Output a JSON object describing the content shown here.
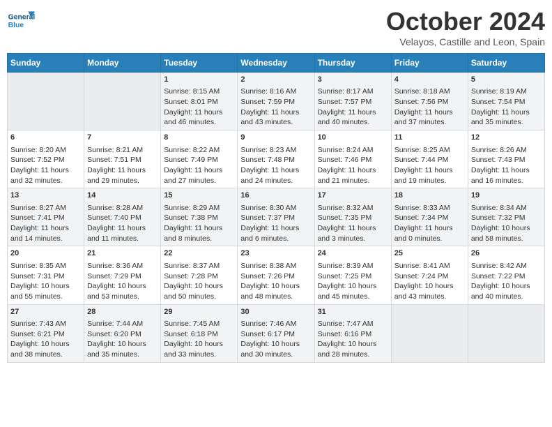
{
  "header": {
    "logo_general": "General",
    "logo_blue": "Blue",
    "month_title": "October 2024",
    "location": "Velayos, Castille and Leon, Spain"
  },
  "days_of_week": [
    "Sunday",
    "Monday",
    "Tuesday",
    "Wednesday",
    "Thursday",
    "Friday",
    "Saturday"
  ],
  "weeks": [
    [
      {
        "day": "",
        "empty": true
      },
      {
        "day": "",
        "empty": true
      },
      {
        "day": "1",
        "sunrise": "8:15 AM",
        "sunset": "8:01 PM",
        "daylight": "11 hours and 46 minutes."
      },
      {
        "day": "2",
        "sunrise": "8:16 AM",
        "sunset": "7:59 PM",
        "daylight": "11 hours and 43 minutes."
      },
      {
        "day": "3",
        "sunrise": "8:17 AM",
        "sunset": "7:57 PM",
        "daylight": "11 hours and 40 minutes."
      },
      {
        "day": "4",
        "sunrise": "8:18 AM",
        "sunset": "7:56 PM",
        "daylight": "11 hours and 37 minutes."
      },
      {
        "day": "5",
        "sunrise": "8:19 AM",
        "sunset": "7:54 PM",
        "daylight": "11 hours and 35 minutes."
      }
    ],
    [
      {
        "day": "6",
        "sunrise": "8:20 AM",
        "sunset": "7:52 PM",
        "daylight": "11 hours and 32 minutes."
      },
      {
        "day": "7",
        "sunrise": "8:21 AM",
        "sunset": "7:51 PM",
        "daylight": "11 hours and 29 minutes."
      },
      {
        "day": "8",
        "sunrise": "8:22 AM",
        "sunset": "7:49 PM",
        "daylight": "11 hours and 27 minutes."
      },
      {
        "day": "9",
        "sunrise": "8:23 AM",
        "sunset": "7:48 PM",
        "daylight": "11 hours and 24 minutes."
      },
      {
        "day": "10",
        "sunrise": "8:24 AM",
        "sunset": "7:46 PM",
        "daylight": "11 hours and 21 minutes."
      },
      {
        "day": "11",
        "sunrise": "8:25 AM",
        "sunset": "7:44 PM",
        "daylight": "11 hours and 19 minutes."
      },
      {
        "day": "12",
        "sunrise": "8:26 AM",
        "sunset": "7:43 PM",
        "daylight": "11 hours and 16 minutes."
      }
    ],
    [
      {
        "day": "13",
        "sunrise": "8:27 AM",
        "sunset": "7:41 PM",
        "daylight": "11 hours and 14 minutes."
      },
      {
        "day": "14",
        "sunrise": "8:28 AM",
        "sunset": "7:40 PM",
        "daylight": "11 hours and 11 minutes."
      },
      {
        "day": "15",
        "sunrise": "8:29 AM",
        "sunset": "7:38 PM",
        "daylight": "11 hours and 8 minutes."
      },
      {
        "day": "16",
        "sunrise": "8:30 AM",
        "sunset": "7:37 PM",
        "daylight": "11 hours and 6 minutes."
      },
      {
        "day": "17",
        "sunrise": "8:32 AM",
        "sunset": "7:35 PM",
        "daylight": "11 hours and 3 minutes."
      },
      {
        "day": "18",
        "sunrise": "8:33 AM",
        "sunset": "7:34 PM",
        "daylight": "11 hours and 0 minutes."
      },
      {
        "day": "19",
        "sunrise": "8:34 AM",
        "sunset": "7:32 PM",
        "daylight": "10 hours and 58 minutes."
      }
    ],
    [
      {
        "day": "20",
        "sunrise": "8:35 AM",
        "sunset": "7:31 PM",
        "daylight": "10 hours and 55 minutes."
      },
      {
        "day": "21",
        "sunrise": "8:36 AM",
        "sunset": "7:29 PM",
        "daylight": "10 hours and 53 minutes."
      },
      {
        "day": "22",
        "sunrise": "8:37 AM",
        "sunset": "7:28 PM",
        "daylight": "10 hours and 50 minutes."
      },
      {
        "day": "23",
        "sunrise": "8:38 AM",
        "sunset": "7:26 PM",
        "daylight": "10 hours and 48 minutes."
      },
      {
        "day": "24",
        "sunrise": "8:39 AM",
        "sunset": "7:25 PM",
        "daylight": "10 hours and 45 minutes."
      },
      {
        "day": "25",
        "sunrise": "8:41 AM",
        "sunset": "7:24 PM",
        "daylight": "10 hours and 43 minutes."
      },
      {
        "day": "26",
        "sunrise": "8:42 AM",
        "sunset": "7:22 PM",
        "daylight": "10 hours and 40 minutes."
      }
    ],
    [
      {
        "day": "27",
        "sunrise": "7:43 AM",
        "sunset": "6:21 PM",
        "daylight": "10 hours and 38 minutes."
      },
      {
        "day": "28",
        "sunrise": "7:44 AM",
        "sunset": "6:20 PM",
        "daylight": "10 hours and 35 minutes."
      },
      {
        "day": "29",
        "sunrise": "7:45 AM",
        "sunset": "6:18 PM",
        "daylight": "10 hours and 33 minutes."
      },
      {
        "day": "30",
        "sunrise": "7:46 AM",
        "sunset": "6:17 PM",
        "daylight": "10 hours and 30 minutes."
      },
      {
        "day": "31",
        "sunrise": "7:47 AM",
        "sunset": "6:16 PM",
        "daylight": "10 hours and 28 minutes."
      },
      {
        "day": "",
        "empty": true
      },
      {
        "day": "",
        "empty": true
      }
    ]
  ]
}
